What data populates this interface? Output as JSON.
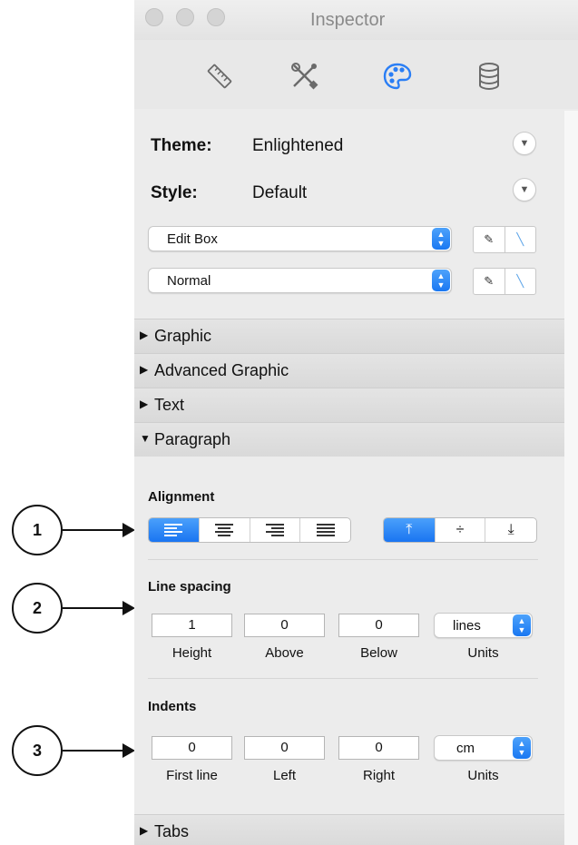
{
  "window": {
    "title": "Inspector"
  },
  "toolbar": {
    "icons": [
      "ruler-icon",
      "tools-icon",
      "palette-icon",
      "database-icon"
    ],
    "active": "palette-icon",
    "accent": "#2a7ef5"
  },
  "theme": {
    "label": "Theme:",
    "value": "Enlightened"
  },
  "style": {
    "label": "Style:",
    "value": "Default"
  },
  "popups": [
    {
      "value": "Edit Box"
    },
    {
      "value": "Normal"
    }
  ],
  "sections": [
    {
      "title": "Graphic",
      "expanded": false
    },
    {
      "title": "Advanced Graphic",
      "expanded": false
    },
    {
      "title": "Text",
      "expanded": false
    },
    {
      "title": "Paragraph",
      "expanded": true
    }
  ],
  "alignment": {
    "label": "Alignment",
    "horizontal": [
      "align-left",
      "align-center",
      "align-right",
      "align-justify"
    ],
    "horizontal_selected": "align-left",
    "vertical": [
      "align-top",
      "align-middle",
      "align-bottom"
    ],
    "vertical_selected": "align-top"
  },
  "line_spacing": {
    "label": "Line spacing",
    "height": "1",
    "above": "0",
    "below": "0",
    "units": "lines",
    "captions": {
      "height": "Height",
      "above": "Above",
      "below": "Below",
      "units": "Units"
    }
  },
  "indents": {
    "label": "Indents",
    "first_line": "0",
    "left": "0",
    "right": "0",
    "units": "cm",
    "captions": {
      "first_line": "First line",
      "left": "Left",
      "right": "Right",
      "units": "Units"
    }
  },
  "tabs_section": {
    "title": "Tabs"
  },
  "callouts": [
    "1",
    "2",
    "3"
  ]
}
